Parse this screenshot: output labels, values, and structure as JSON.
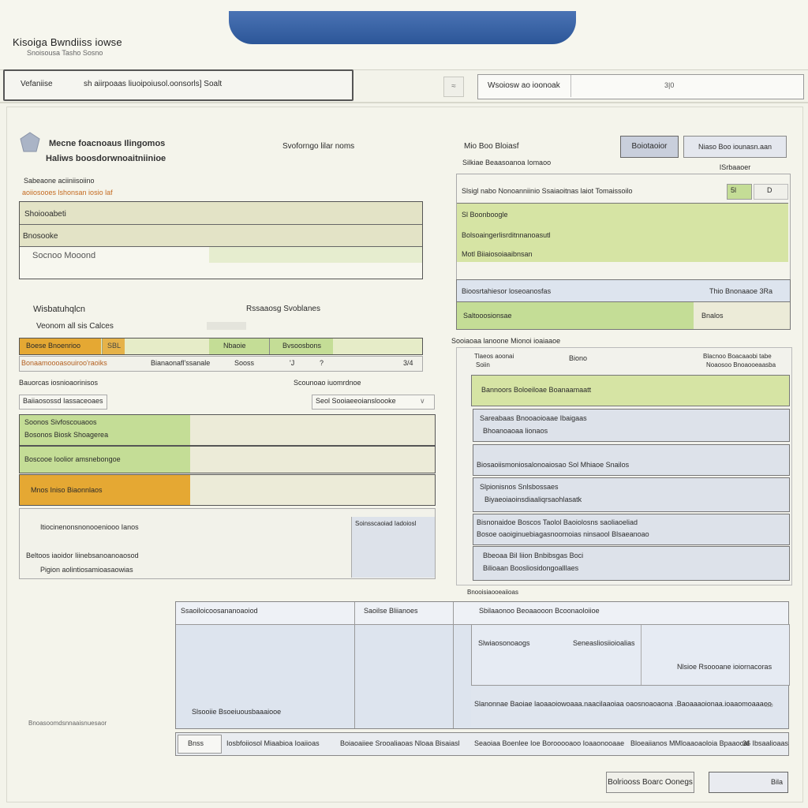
{
  "app": {
    "title": "Kisoiga Bwndiiss iowse",
    "subtitle": "Snoisousa Tasho Sosno"
  },
  "header": {
    "path_label": "Vefaniise",
    "path_value": "sh aiirpoaas liuoipoiusol.oonsorls] Soalt",
    "icon_button": "≈",
    "right_segment_1": "Wsoiosw ao ioonoak",
    "right_segment_2": "3|0"
  },
  "left_panel": {
    "heading_1": "Mecne foacnoaus Ilingomos",
    "heading_2": "Haliws boosdorwnoaitniinioe",
    "heading_center": "Svoforngo lilar noms",
    "sub_label_1": "Sabeaone aciiniisoiino",
    "sub_label_2": "aoiiosooes lshonsan iosio laf",
    "rows": [
      "Shoiooabeti",
      "Bnosooke",
      "Socnoo Mooond"
    ],
    "section_2_title": "Wisbatuhqlcn",
    "section_2_center": "Rssaaosg Svoblanes",
    "section_2_label": "Veonom all sis Calces",
    "status_row": {
      "orange_label": "Boese Bnoenrioo",
      "orange_value": "SBL",
      "lime_1": "Nbaoie",
      "lime_2": "Bvsoosbons"
    },
    "status_row_2": {
      "left": "Bonaamoooasouiroo'raoiks",
      "mid": "Bianaonafl'ssanale",
      "mid2": "Sooss",
      "val1": "'J",
      "val2": "?",
      "val3": "3/4"
    },
    "section_3_title": "Bauorcas iosnioaorinisos",
    "section_3_right": "Scounoao iuomrdnoe",
    "input_left": "Baiiaosossd Iassaceoaes",
    "input_right": "Seol Sooiaeeoiansloooke",
    "list": [
      {
        "label": "Soonos Sivfoscouaoos",
        "label2": "Bosonos Biosk Shoagerea",
        "color": "lime"
      },
      {
        "label": "Boscooe Ioolior amsnebongoe",
        "color": "lime"
      },
      {
        "label": "Mnos Iniso Biaonnlaos",
        "color": "orange"
      }
    ],
    "footer_1": "Itiocinenonsnonooeniooo Ianos",
    "footer_2": "Beltoos iaoidor Iiinebsanoanoaosod",
    "footer_3": "Pigion aolintiosamioasaowias",
    "footer_small": "Soinsscaoiad Iadoiosl",
    "footer_note": "Bnoasoomdsnnaaisnuesaor"
  },
  "right_panel": {
    "heading": "Mio Boo Bloiasf",
    "sub": "Silkiae Beaasoanoa Iomaoo",
    "btn_1": "Boiotaoior",
    "btn_2": "Niaso Boo iounasn.aan ISrbaaoer",
    "top_line": "Slsigl nabo Nonoanniinio Ssaiaoitnas laiot Tomaissoilo",
    "top_badge": "5l",
    "top_badge2": "D",
    "rows": [
      "Sl Boonboogle",
      "Bolsoaingerlisrditnnanoasutl",
      "Motl Biiaiosoiaaibnsan"
    ],
    "blue_row": "Bioosrtahiesor loseoanosfas",
    "blue_row_right": "Thio Bnonaaoe 3Ra",
    "green_row": "Saltooosionsae",
    "green_row_right": "Bnalos",
    "section_title": "Sooiaoaa lanoone  Mionoi ioaiaaoe",
    "col_1a": "Tlaeos aoonai",
    "col_1b": "Soiin",
    "col_2": "Biono",
    "col_3a": "Blacnoo Boacaaobi tabe",
    "col_3b": "Noaosoo Bnoaooeaasba",
    "highlight": "Bannoors Boloeiloae Boanaamaatt",
    "cards": [
      {
        "l1": "Sareabaas Bnooaoioaae Ibaigaas",
        "l2": "Bhoanoaoaa lionaos"
      },
      {
        "l1": "Biosaoiismoniosalonoaiosao Sol Mhiaoe Snailos"
      },
      {
        "l1": "Slpionisnos Snlsbossaes",
        "l2": "Biyaeoiaoinsdiaaliqrsaohlasatk"
      },
      {
        "l1": "Bisnonaidoe Boscos Taolol Baoiolosns saoliaoeliad",
        "l2": "Bosoe oaoiginuebiagasnoomoias ninsaool Blsaeanoao"
      },
      {
        "l1": "Bbeoaa Bil Iiion Bnbibsgas Boci",
        "l2": "Bilioaan Boosliosidongoalllaes"
      }
    ],
    "footer_title": "Bnooisiaooeaiioas"
  },
  "bottom": {
    "table_col_1": "Ssaoiloicoosananoaoiod",
    "table_col_2": "Saoilse Bliianoes",
    "table_col_3": "Sbilaaonoo Beoaaooon Bcoonaoloiioe",
    "table_row_a": "Slwiaosonoaogs",
    "table_row_b": "Seneasliosiioioalias",
    "table_right_note": "Nlsioe Rsoooane ioiornacoras",
    "table_bottom_left": "Slsooiie Bsoeiuousbaaaiooe",
    "status_line": "Slanonnae Baoiae laoaaoiowoaaa.naacilaaoiaa oaosnoaoaona .Baoaaaoionaa.ioaaomoaaaoo",
    "status_line_right": "loo",
    "tabs": [
      "Bnss",
      "Iosbfoiiosol Miaabioa Ioaiioas",
      "Boiaoaiiee Srooaliaoas Nloaa Bisaiasl",
      "Seaoiaa Boenlee Ioe Borooooaoo Ioaaonooaae",
      "Bloeaiianos MMloaaoaoloia Bpaaooal",
      "36 Ibsaalioaas"
    ],
    "button_1": "Bolriooss Boarc Oonegs",
    "button_2": "Bila"
  }
}
